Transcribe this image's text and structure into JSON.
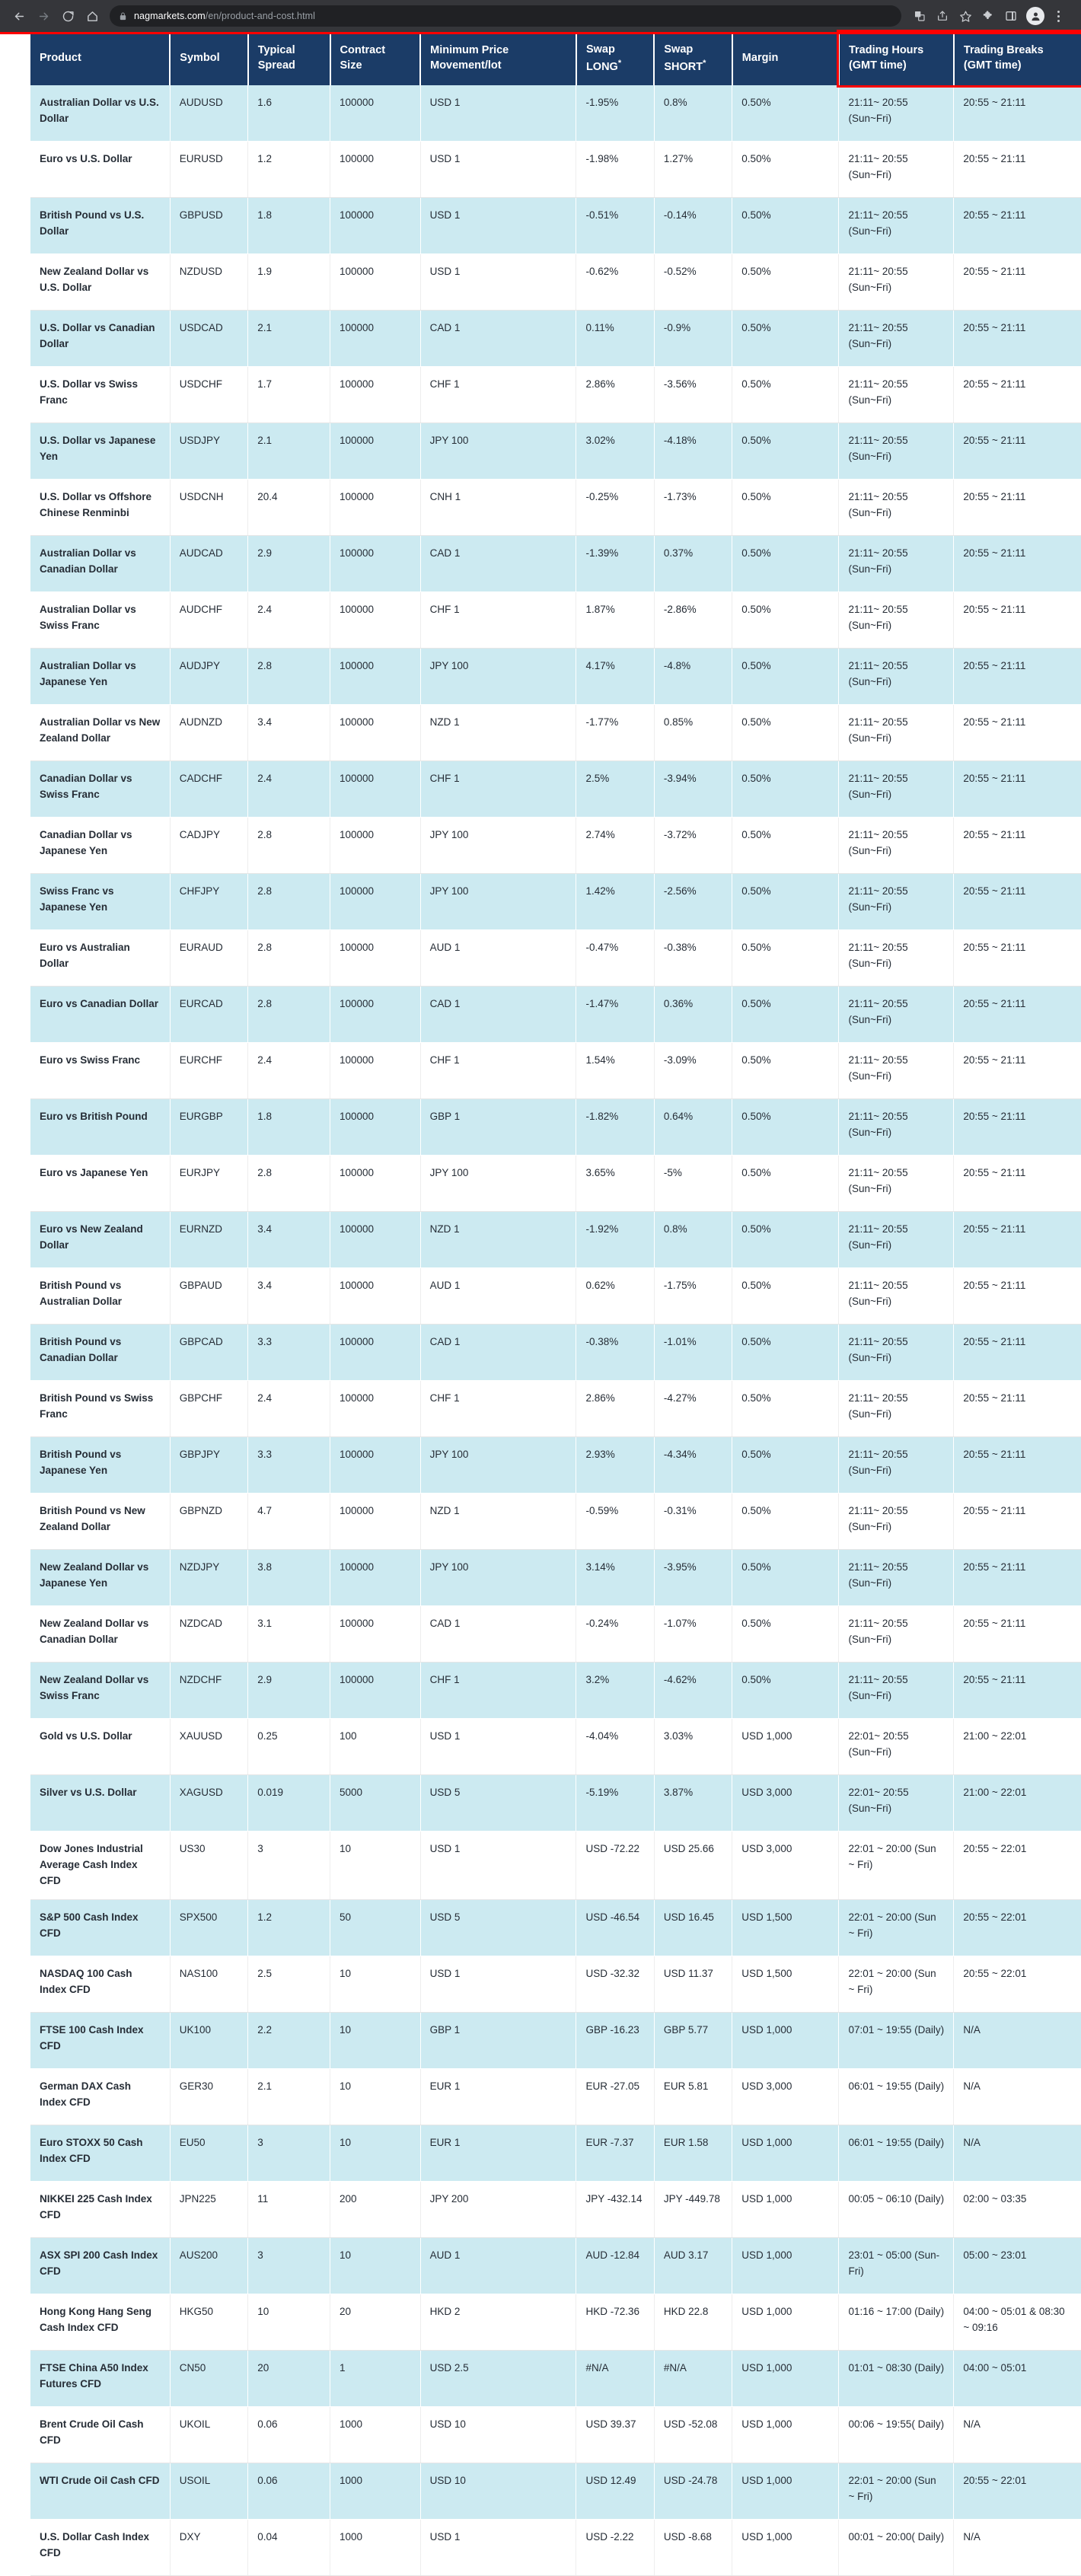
{
  "browser": {
    "back_icon": "back-arrow-icon",
    "forward_icon": "forward-arrow-icon",
    "reload_icon": "reload-icon",
    "home_icon": "home-icon",
    "lock_icon": "lock-icon",
    "url_host": "nagmarkets.com",
    "url_path": "/en/product-and-cost.html",
    "translate_icon": "translate-icon",
    "share_icon": "share-icon",
    "bookmark_icon": "star-icon",
    "extensions_icon": "puzzle-icon",
    "sidepanel_icon": "side-panel-icon",
    "profile_icon": "profile-avatar-icon",
    "menu_icon": "three-dot-menu-icon"
  },
  "annotation": {
    "highlight_color": "#ff0000"
  },
  "table": {
    "columns": [
      "Product",
      "Symbol",
      "Typical Spread",
      "Contract Size",
      "Minimum Price Movement/lot",
      "Swap LONG",
      "Swap SHORT",
      "Margin",
      "Trading Hours (GMT time)",
      "Trading Breaks (GMT time)"
    ],
    "header_star": "*",
    "rows": [
      [
        "Australian Dollar vs U.S. Dollar",
        "AUDUSD",
        "1.6",
        "100000",
        "USD 1",
        "-1.95%",
        "0.8%",
        "0.50%",
        "21:11~ 20:55 (Sun~Fri)",
        "20:55 ~ 21:11"
      ],
      [
        "Euro vs U.S. Dollar",
        "EURUSD",
        "1.2",
        "100000",
        "USD 1",
        "-1.98%",
        "1.27%",
        "0.50%",
        "21:11~ 20:55 (Sun~Fri)",
        "20:55 ~ 21:11"
      ],
      [
        "British Pound vs U.S. Dollar",
        "GBPUSD",
        "1.8",
        "100000",
        "USD 1",
        "-0.51%",
        "-0.14%",
        "0.50%",
        "21:11~ 20:55 (Sun~Fri)",
        "20:55 ~ 21:11"
      ],
      [
        "New Zealand Dollar vs U.S. Dollar",
        "NZDUSD",
        "1.9",
        "100000",
        "USD 1",
        "-0.62%",
        "-0.52%",
        "0.50%",
        "21:11~ 20:55 (Sun~Fri)",
        "20:55 ~ 21:11"
      ],
      [
        "U.S. Dollar vs Canadian Dollar",
        "USDCAD",
        "2.1",
        "100000",
        "CAD 1",
        "0.11%",
        "-0.9%",
        "0.50%",
        "21:11~ 20:55 (Sun~Fri)",
        "20:55 ~ 21:11"
      ],
      [
        "U.S. Dollar vs Swiss Franc",
        "USDCHF",
        "1.7",
        "100000",
        "CHF 1",
        "2.86%",
        "-3.56%",
        "0.50%",
        "21:11~ 20:55 (Sun~Fri)",
        "20:55 ~ 21:11"
      ],
      [
        "U.S. Dollar vs Japanese Yen",
        "USDJPY",
        "2.1",
        "100000",
        "JPY 100",
        "3.02%",
        "-4.18%",
        "0.50%",
        "21:11~ 20:55 (Sun~Fri)",
        "20:55 ~ 21:11"
      ],
      [
        "U.S. Dollar vs Offshore Chinese Renminbi",
        "USDCNH",
        "20.4",
        "100000",
        "CNH 1",
        "-0.25%",
        "-1.73%",
        "0.50%",
        "21:11~ 20:55 (Sun~Fri)",
        "20:55 ~ 21:11"
      ],
      [
        "Australian Dollar vs Canadian Dollar",
        "AUDCAD",
        "2.9",
        "100000",
        "CAD 1",
        "-1.39%",
        "0.37%",
        "0.50%",
        "21:11~ 20:55 (Sun~Fri)",
        "20:55 ~ 21:11"
      ],
      [
        "Australian Dollar vs Swiss Franc",
        "AUDCHF",
        "2.4",
        "100000",
        "CHF 1",
        "1.87%",
        "-2.86%",
        "0.50%",
        "21:11~ 20:55 (Sun~Fri)",
        "20:55 ~ 21:11"
      ],
      [
        "Australian Dollar vs Japanese Yen",
        "AUDJPY",
        "2.8",
        "100000",
        "JPY 100",
        "4.17%",
        "-4.8%",
        "0.50%",
        "21:11~ 20:55 (Sun~Fri)",
        "20:55 ~ 21:11"
      ],
      [
        "Australian Dollar vs New Zealand Dollar",
        "AUDNZD",
        "3.4",
        "100000",
        "NZD 1",
        "-1.77%",
        "0.85%",
        "0.50%",
        "21:11~ 20:55 (Sun~Fri)",
        "20:55 ~ 21:11"
      ],
      [
        "Canadian Dollar vs Swiss Franc",
        "CADCHF",
        "2.4",
        "100000",
        "CHF 1",
        "2.5%",
        "-3.94%",
        "0.50%",
        "21:11~ 20:55 (Sun~Fri)",
        "20:55 ~ 21:11"
      ],
      [
        "Canadian Dollar vs Japanese Yen",
        "CADJPY",
        "2.8",
        "100000",
        "JPY 100",
        "2.74%",
        "-3.72%",
        "0.50%",
        "21:11~ 20:55 (Sun~Fri)",
        "20:55 ~ 21:11"
      ],
      [
        "Swiss Franc vs Japanese Yen",
        "CHFJPY",
        "2.8",
        "100000",
        "JPY 100",
        "1.42%",
        "-2.56%",
        "0.50%",
        "21:11~ 20:55 (Sun~Fri)",
        "20:55 ~ 21:11"
      ],
      [
        "Euro vs Australian Dollar",
        "EURAUD",
        "2.8",
        "100000",
        "AUD 1",
        "-0.47%",
        "-0.38%",
        "0.50%",
        "21:11~ 20:55 (Sun~Fri)",
        "20:55 ~ 21:11"
      ],
      [
        "Euro vs Canadian Dollar",
        "EURCAD",
        "2.8",
        "100000",
        "CAD 1",
        "-1.47%",
        "0.36%",
        "0.50%",
        "21:11~ 20:55 (Sun~Fri)",
        "20:55 ~ 21:11"
      ],
      [
        "Euro vs Swiss Franc",
        "EURCHF",
        "2.4",
        "100000",
        "CHF 1",
        "1.54%",
        "-3.09%",
        "0.50%",
        "21:11~ 20:55 (Sun~Fri)",
        "20:55 ~ 21:11"
      ],
      [
        "Euro vs British Pound",
        "EURGBP",
        "1.8",
        "100000",
        "GBP 1",
        "-1.82%",
        "0.64%",
        "0.50%",
        "21:11~ 20:55 (Sun~Fri)",
        "20:55 ~ 21:11"
      ],
      [
        "Euro vs Japanese Yen",
        "EURJPY",
        "2.8",
        "100000",
        "JPY 100",
        "3.65%",
        "-5%",
        "0.50%",
        "21:11~ 20:55 (Sun~Fri)",
        "20:55 ~ 21:11"
      ],
      [
        "Euro vs New Zealand Dollar",
        "EURNZD",
        "3.4",
        "100000",
        "NZD 1",
        "-1.92%",
        "0.8%",
        "0.50%",
        "21:11~ 20:55 (Sun~Fri)",
        "20:55 ~ 21:11"
      ],
      [
        "British Pound vs Australian Dollar",
        "GBPAUD",
        "3.4",
        "100000",
        "AUD 1",
        "0.62%",
        "-1.75%",
        "0.50%",
        "21:11~ 20:55 (Sun~Fri)",
        "20:55 ~ 21:11"
      ],
      [
        "British Pound vs Canadian Dollar",
        "GBPCAD",
        "3.3",
        "100000",
        "CAD 1",
        "-0.38%",
        "-1.01%",
        "0.50%",
        "21:11~ 20:55 (Sun~Fri)",
        "20:55 ~ 21:11"
      ],
      [
        "British Pound vs Swiss Franc",
        "GBPCHF",
        "2.4",
        "100000",
        "CHF 1",
        "2.86%",
        "-4.27%",
        "0.50%",
        "21:11~ 20:55 (Sun~Fri)",
        "20:55 ~ 21:11"
      ],
      [
        "British Pound vs Japanese Yen",
        "GBPJPY",
        "3.3",
        "100000",
        "JPY 100",
        "2.93%",
        "-4.34%",
        "0.50%",
        "21:11~ 20:55 (Sun~Fri)",
        "20:55 ~ 21:11"
      ],
      [
        "British Pound vs New Zealand Dollar",
        "GBPNZD",
        "4.7",
        "100000",
        "NZD 1",
        "-0.59%",
        "-0.31%",
        "0.50%",
        "21:11~ 20:55 (Sun~Fri)",
        "20:55 ~ 21:11"
      ],
      [
        "New Zealand Dollar vs Japanese Yen",
        "NZDJPY",
        "3.8",
        "100000",
        "JPY 100",
        "3.14%",
        "-3.95%",
        "0.50%",
        "21:11~ 20:55 (Sun~Fri)",
        "20:55 ~ 21:11"
      ],
      [
        "New Zealand Dollar vs Canadian Dollar",
        "NZDCAD",
        "3.1",
        "100000",
        "CAD 1",
        "-0.24%",
        "-1.07%",
        "0.50%",
        "21:11~ 20:55 (Sun~Fri)",
        "20:55 ~ 21:11"
      ],
      [
        "New Zealand Dollar vs Swiss Franc",
        "NZDCHF",
        "2.9",
        "100000",
        "CHF 1",
        "3.2%",
        "-4.62%",
        "0.50%",
        "21:11~ 20:55 (Sun~Fri)",
        "20:55 ~ 21:11"
      ],
      [
        "Gold vs U.S. Dollar",
        "XAUUSD",
        "0.25",
        "100",
        "USD 1",
        "-4.04%",
        "3.03%",
        "USD 1,000",
        "22:01~ 20:55 (Sun~Fri)",
        "21:00 ~ 22:01"
      ],
      [
        "Silver vs U.S. Dollar",
        "XAGUSD",
        "0.019",
        "5000",
        "USD 5",
        "-5.19%",
        "3.87%",
        "USD 3,000",
        "22:01~ 20:55 (Sun~Fri)",
        "21:00 ~ 22:01"
      ],
      [
        "Dow Jones Industrial Average Cash Index CFD",
        "US30",
        "3",
        "10",
        "USD 1",
        "USD -72.22",
        "USD 25.66",
        "USD 3,000",
        "22:01 ~ 20:00 (Sun ~ Fri)",
        "20:55 ~ 22:01"
      ],
      [
        "S&P 500 Cash Index CFD",
        "SPX500",
        "1.2",
        "50",
        "USD 5",
        "USD -46.54",
        "USD 16.45",
        "USD 1,500",
        "22:01 ~ 20:00 (Sun ~ Fri)",
        "20:55 ~ 22:01"
      ],
      [
        "NASDAQ 100 Cash Index CFD",
        "NAS100",
        "2.5",
        "10",
        "USD 1",
        "USD -32.32",
        "USD 11.37",
        "USD 1,500",
        "22:01 ~ 20:00 (Sun ~ Fri)",
        "20:55 ~ 22:01"
      ],
      [
        "FTSE 100 Cash Index CFD",
        "UK100",
        "2.2",
        "10",
        "GBP 1",
        "GBP -16.23",
        "GBP 5.77",
        "USD 1,000",
        "07:01 ~ 19:55 (Daily)",
        "N/A"
      ],
      [
        "German DAX Cash Index CFD",
        "GER30",
        "2.1",
        "10",
        "EUR 1",
        "EUR -27.05",
        "EUR 5.81",
        "USD 3,000",
        "06:01 ~ 19:55 (Daily)",
        "N/A"
      ],
      [
        "Euro STOXX 50 Cash Index CFD",
        "EU50",
        "3",
        "10",
        "EUR 1",
        "EUR -7.37",
        "EUR 1.58",
        "USD 1,000",
        "06:01 ~ 19:55 (Daily)",
        "N/A"
      ],
      [
        "NIKKEI 225 Cash Index CFD",
        "JPN225",
        "11",
        "200",
        "JPY 200",
        "JPY -432.14",
        "JPY -449.78",
        "USD 1,000",
        "00:05 ~ 06:10 (Daily)",
        "02:00 ~ 03:35"
      ],
      [
        "ASX SPI 200 Cash Index CFD",
        "AUS200",
        "3",
        "10",
        "AUD 1",
        "AUD -12.84",
        "AUD 3.17",
        "USD 1,000",
        "23:01 ~ 05:00 (Sun-Fri)",
        "05:00 ~ 23:01"
      ],
      [
        "Hong Kong Hang Seng Cash Index CFD",
        "HKG50",
        "10",
        "20",
        "HKD 2",
        "HKD -72.36",
        "HKD 22.8",
        "USD 1,000",
        "01:16 ~ 17:00 (Daily)",
        "04:00 ~ 05:01 & 08:30 ~ 09:16"
      ],
      [
        "FTSE China A50 Index Futures CFD",
        "CN50",
        "20",
        "1",
        "USD 2.5",
        "#N/A",
        "#N/A",
        "USD 1,000",
        "01:01 ~ 08:30 (Daily)",
        "04:00 ~ 05:01"
      ],
      [
        "Brent Crude Oil Cash CFD",
        "UKOIL",
        "0.06",
        "1000",
        "USD 10",
        "USD 39.37",
        "USD -52.08",
        "USD 1,000",
        "00:06 ~ 19:55( Daily)",
        "N/A"
      ],
      [
        "WTI Crude Oil Cash CFD",
        "USOIL",
        "0.06",
        "1000",
        "USD 10",
        "USD 12.49",
        "USD -24.78",
        "USD 1,000",
        "22:01 ~ 20:00 (Sun ~ Fri)",
        "20:55 ~ 22:01"
      ],
      [
        "U.S. Dollar Cash Index CFD",
        "DXY",
        "0.04",
        "1000",
        "USD 1",
        "USD -2.22",
        "USD -8.68",
        "USD 1,000",
        "00:01 ~ 20:00( Daily)",
        "N/A"
      ]
    ]
  }
}
